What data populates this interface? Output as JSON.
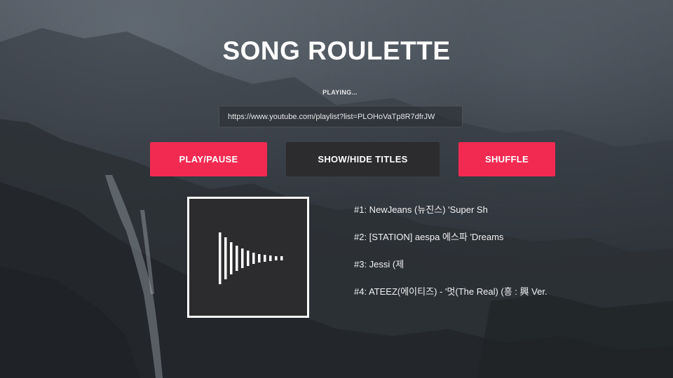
{
  "app": {
    "title": "SONG ROULETTE"
  },
  "status": {
    "text": "PLAYING..."
  },
  "playlist_input": {
    "value": "https://www.youtube.com/playlist?list=PLOHoVaTp8R7dfrJW"
  },
  "controls": {
    "play_pause_label": "PLAY/PAUSE",
    "toggle_titles_label": "SHOW/HIDE TITLES",
    "shuffle_label": "SHUFFLE"
  },
  "artwork": {
    "icon": "audio-waveform-icon"
  },
  "songs": [
    {
      "label": "#1: NewJeans (뉴진스) 'Super Sh"
    },
    {
      "label": "#2: [STATION] aespa 에스파 'Dreams"
    },
    {
      "label": "#3: Jessi (제"
    },
    {
      "label": "#4: ATEEZ(에이티즈) - '멋(The Real) (흥 : 興 Ver."
    }
  ],
  "colors": {
    "accent": "#f22a52",
    "button_dark": "#2c2b2e",
    "artwork_bg": "#2c2b2e",
    "text": "#ffffff"
  }
}
